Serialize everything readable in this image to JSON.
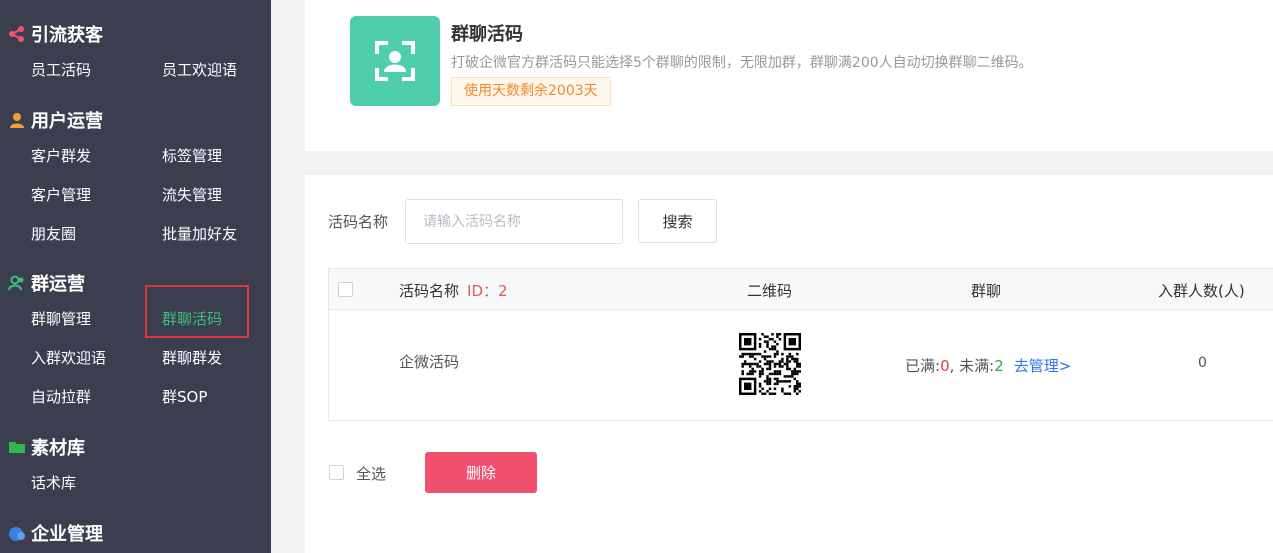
{
  "sidebar": {
    "sections": [
      {
        "title": "引流获客",
        "items": [
          "员工活码",
          "员工欢迎语"
        ]
      },
      {
        "title": "用户运营",
        "items": [
          "客户群发",
          "标签管理",
          "客户管理",
          "流失管理",
          "朋友圈",
          "批量加好友"
        ]
      },
      {
        "title": "群运营",
        "items": [
          "群聊管理",
          "群聊活码",
          "入群欢迎语",
          "群聊群发",
          "自动拉群",
          "群SOP"
        ]
      },
      {
        "title": "素材库",
        "items": [
          "话术库"
        ]
      },
      {
        "title": "企业管理",
        "items": []
      }
    ],
    "active_item": "群聊活码",
    "colors": {
      "bg": "#3a3e4f",
      "active": "#3ec07a",
      "highlight_box": "#e0373a"
    }
  },
  "app": {
    "title": "群聊活码",
    "description": "打破企微官方群活码只能选择5个群聊的限制，无限加群，群聊满200人自动切换群聊二维码。",
    "badge": "使用天数剩余2003天",
    "icon": "qr-scan-icon",
    "icon_color": "#4ecfa9"
  },
  "search": {
    "label": "活码名称",
    "placeholder": "请输入活码名称",
    "value": "",
    "button": "搜索"
  },
  "table": {
    "headers": {
      "name": "活码名称",
      "id": "ID：2",
      "qrcode": "二维码",
      "group": "群聊",
      "joined": "入群人数(人)"
    },
    "rows": [
      {
        "name": "企微活码",
        "full_label": "已满:",
        "full_count": "0",
        "sep": ", 未满:",
        "notfull_count": "2",
        "manage_link": "去管理>",
        "joined": "0"
      }
    ]
  },
  "footer": {
    "select_all": "全选",
    "delete": "删除",
    "delete_color": "#f0506e"
  }
}
